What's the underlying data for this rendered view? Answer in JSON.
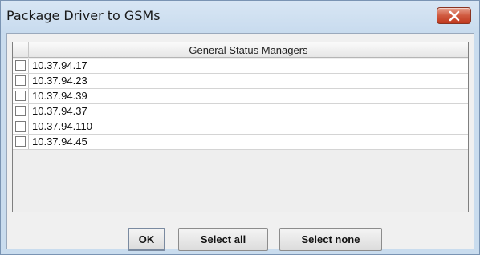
{
  "window": {
    "title": "Package Driver to GSMs",
    "close_icon": "close-x-icon",
    "close_color": "#c8412a"
  },
  "table": {
    "header": "General Status Managers",
    "rows": [
      {
        "ip": "10.37.94.17",
        "checked": false
      },
      {
        "ip": "10.37.94.23",
        "checked": false
      },
      {
        "ip": "10.37.94.39",
        "checked": false
      },
      {
        "ip": "10.37.94.37",
        "checked": false
      },
      {
        "ip": "10.37.94.110",
        "checked": false
      },
      {
        "ip": "10.37.94.45",
        "checked": false
      }
    ]
  },
  "buttons": {
    "ok": "OK",
    "select_all": "Select all",
    "select_none": "Select none"
  }
}
